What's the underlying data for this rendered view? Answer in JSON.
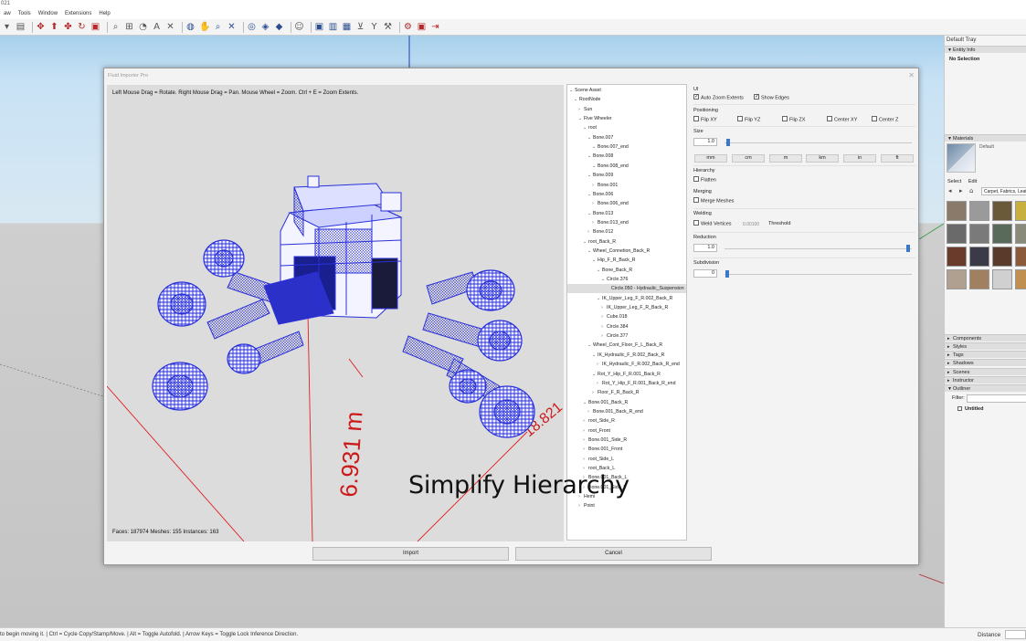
{
  "app": {
    "title_fragment": "021",
    "menus": [
      "aw",
      "Tools",
      "Window",
      "Extensions",
      "Help"
    ]
  },
  "status": {
    "hint": "to begin moving it. | Ctrl = Cycle Copy/Stamp/Move. | Alt = Toggle Autofold. | Arrow Keys = Toggle Lock Inference Direction.",
    "measurements_label": "Distance"
  },
  "tray": {
    "title": "Default Tray",
    "entity_info": {
      "header": "Entity Info",
      "value": "No Selection"
    },
    "materials": {
      "header": "Materials",
      "current": "Default",
      "tabs": [
        "Select",
        "Edit"
      ],
      "collection": "Carpet, Fabrics, Leath"
    },
    "panels": [
      "Components",
      "Styles",
      "Tags",
      "Shadows",
      "Scenes",
      "Instructor",
      "Outliner"
    ],
    "outliner": {
      "filter_label": "Filter:",
      "item": "Untitled"
    },
    "swatch_colors": [
      "#8a7a6a",
      "#9a9a9a",
      "#6b5a3a",
      "#c8b040",
      "#6a6a6a",
      "#7a7a7a",
      "#5a6a5a",
      "#8a8a7a",
      "#6a3a2a",
      "#3a3a48",
      "#5a3a2a",
      "#8a5a3a",
      "#b0a090",
      "#a08060",
      "#d0d0d0",
      "#c09050"
    ]
  },
  "dialog": {
    "title": "Fluid Importer Pro",
    "instructions": "Left Mouse Drag = Rotate. Right Mouse Drag = Pan. Mouse Wheel = Zoom. Ctrl + E = Zoom Extents.",
    "stats": "Faces: 187974   Meshes: 155   Instances: 163",
    "dim_label_1": "6.931 m",
    "dim_label_2": "18.821",
    "import_button": "Import",
    "cancel_button": "Cancel",
    "tree": [
      {
        "label": "Scene Asset",
        "depth": 0,
        "twisty": "open"
      },
      {
        "label": "RootNode",
        "depth": 1,
        "twisty": "open"
      },
      {
        "label": "Sun",
        "depth": 2,
        "twisty": "closed"
      },
      {
        "label": "Five Wheeler",
        "depth": 2,
        "twisty": "open"
      },
      {
        "label": "root",
        "depth": 3,
        "twisty": "open"
      },
      {
        "label": "Bone.007",
        "depth": 4,
        "twisty": "open"
      },
      {
        "label": "Bone.007_end",
        "depth": 5,
        "twisty": "open"
      },
      {
        "label": "Bone.008",
        "depth": 4,
        "twisty": "open"
      },
      {
        "label": "Bone.008_end",
        "depth": 5,
        "twisty": "open"
      },
      {
        "label": "Bone.009",
        "depth": 4,
        "twisty": "open"
      },
      {
        "label": "Bone.001",
        "depth": 5,
        "twisty": "closed"
      },
      {
        "label": "Bone.006",
        "depth": 4,
        "twisty": "open"
      },
      {
        "label": "Bone.006_end",
        "depth": 5,
        "twisty": "closed"
      },
      {
        "label": "Bone.013",
        "depth": 4,
        "twisty": "open"
      },
      {
        "label": "Bone.013_end",
        "depth": 5,
        "twisty": "closed"
      },
      {
        "label": "Bone.012",
        "depth": 4,
        "twisty": "closed"
      },
      {
        "label": "root_Back_R",
        "depth": 3,
        "twisty": "open"
      },
      {
        "label": "Wheel_Connetion_Back_R",
        "depth": 4,
        "twisty": "open"
      },
      {
        "label": "Hip_F_R_Back_R",
        "depth": 5,
        "twisty": "open"
      },
      {
        "label": "Bone_Back_R",
        "depth": 6,
        "twisty": "open"
      },
      {
        "label": "Circle.376",
        "depth": 7,
        "twisty": "open"
      },
      {
        "label": "Circle.050 - Hydraulic_Suspension",
        "depth": 8,
        "twisty": "none",
        "selected": true
      },
      {
        "label": "IK_Upper_Leg_F_R.002_Back_R",
        "depth": 6,
        "twisty": "open"
      },
      {
        "label": "IK_Upper_Leg_F_R_Back_R",
        "depth": 7,
        "twisty": "closed"
      },
      {
        "label": "Cube.018",
        "depth": 7,
        "twisty": "closed"
      },
      {
        "label": "Circle.384",
        "depth": 7,
        "twisty": "closed"
      },
      {
        "label": "Circle.377",
        "depth": 7,
        "twisty": "closed"
      },
      {
        "label": "Wheel_Cont_Floor_F_L_Back_R",
        "depth": 4,
        "twisty": "open"
      },
      {
        "label": "IK_Hydraulic_F_R.002_Back_R",
        "depth": 5,
        "twisty": "open"
      },
      {
        "label": "IK_Hydraulic_F_R.002_Back_R_end",
        "depth": 6,
        "twisty": "closed"
      },
      {
        "label": "Rot_Y_Hip_F_R.001_Back_R",
        "depth": 5,
        "twisty": "open"
      },
      {
        "label": "Rot_Y_Hip_F_R.001_Back_R_end",
        "depth": 6,
        "twisty": "closed"
      },
      {
        "label": "Floor_F_R_Back_R",
        "depth": 5,
        "twisty": "closed"
      },
      {
        "label": "Bone.001_Back_R",
        "depth": 3,
        "twisty": "open"
      },
      {
        "label": "Bone.001_Back_R_end",
        "depth": 4,
        "twisty": "closed"
      },
      {
        "label": "root_Side_R",
        "depth": 3,
        "twisty": "closed"
      },
      {
        "label": "root_Front",
        "depth": 3,
        "twisty": "closed"
      },
      {
        "label": "Bone.001_Side_R",
        "depth": 3,
        "twisty": "closed"
      },
      {
        "label": "Bone.001_Front",
        "depth": 3,
        "twisty": "closed"
      },
      {
        "label": "root_Side_L",
        "depth": 3,
        "twisty": "closed"
      },
      {
        "label": "root_Back_L",
        "depth": 3,
        "twisty": "closed"
      },
      {
        "label": "Bone.001_Back_L",
        "depth": 3,
        "twisty": "closed"
      },
      {
        "label": "Bone.001_Side_L",
        "depth": 3,
        "twisty": "closed"
      },
      {
        "label": "Hemi",
        "depth": 2,
        "twisty": "closed"
      },
      {
        "label": "Point",
        "depth": 2,
        "twisty": "closed"
      }
    ],
    "settings": {
      "ui": {
        "header": "UI",
        "auto_zoom_label": "Auto Zoom Extents",
        "auto_zoom": true,
        "show_edges_label": "Show Edges",
        "show_edges": true
      },
      "positioning": {
        "header": "Positioning",
        "flip_xy": "Flip XY",
        "flip_yz": "Flip YZ",
        "flip_zx": "Flip ZX",
        "center_xy": "Center XY",
        "center_z": "Center Z"
      },
      "size": {
        "header": "Size",
        "value": "1.0",
        "units": [
          "mm",
          "cm",
          "m",
          "km",
          "in",
          "ft"
        ]
      },
      "hierarchy": {
        "header": "Hierarchy",
        "flatten_label": "Flatten"
      },
      "merging": {
        "header": "Merging",
        "merge_label": "Merge Meshes"
      },
      "welding": {
        "header": "Welding",
        "weld_label": "Weld Vertices",
        "value": "0.00100",
        "threshold_label": "Threshold"
      },
      "reduction": {
        "header": "Reduction",
        "value": "1.0"
      },
      "subdivision": {
        "header": "Subdivision",
        "value": "0"
      }
    }
  },
  "caption": "Simplify Hierarchy"
}
